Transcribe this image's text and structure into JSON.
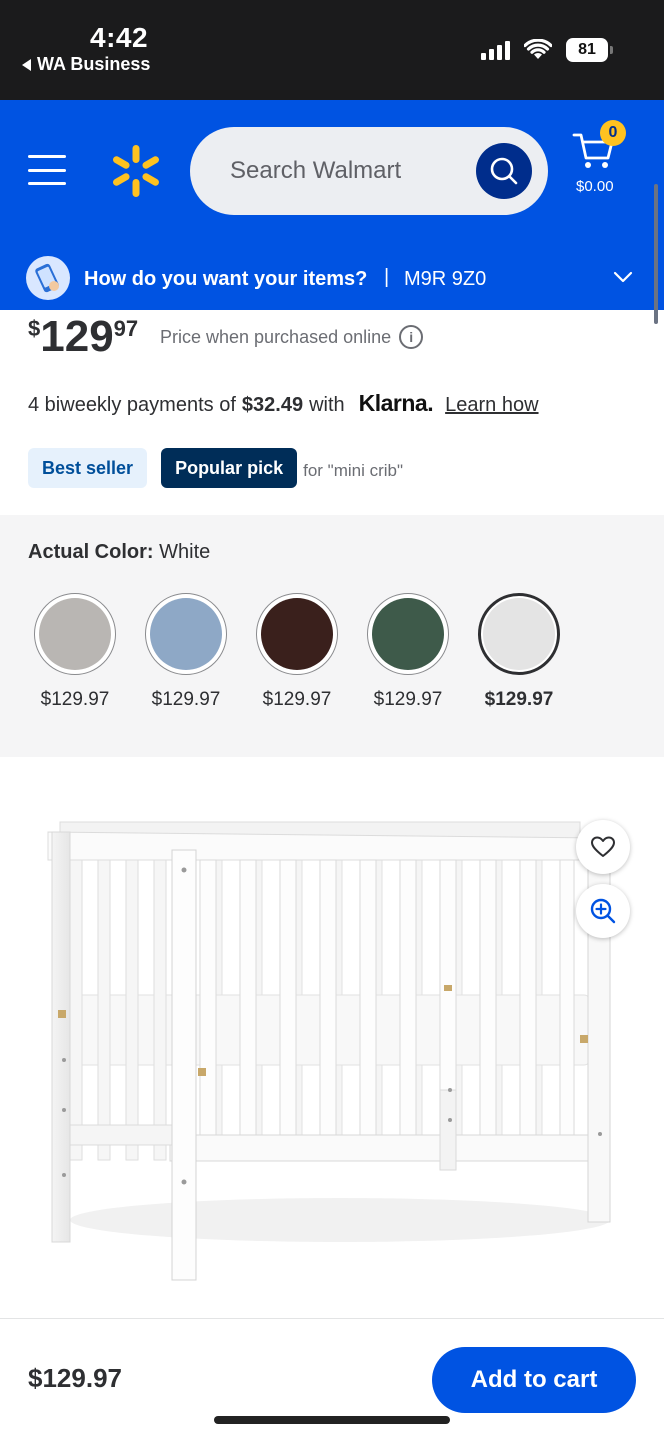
{
  "status_bar": {
    "time": "4:42",
    "back_app": "WA Business",
    "battery": "81"
  },
  "header": {
    "search_placeholder": "Search Walmart",
    "cart_count": "0",
    "cart_total": "$0.00",
    "brand_color": "#0053e2",
    "spark_color": "#ffc220"
  },
  "delivery": {
    "question": "How do you want your items?",
    "separator": "|",
    "postal_code": "M9R 9Z0"
  },
  "price": {
    "currency": "$",
    "dollars": "129",
    "cents": "97",
    "note": "Price when purchased online",
    "info_icon": "i"
  },
  "klarna": {
    "prefix": "4 biweekly payments of",
    "amount": "$32.49",
    "with": "with",
    "logo": "Klarna.",
    "link": "Learn how"
  },
  "badges": {
    "best_seller": "Best seller",
    "popular_pick": "Popular pick",
    "context": "for \"mini crib\""
  },
  "color": {
    "label": "Actual Color:",
    "selected": "White",
    "swatches": [
      {
        "color": "#b9b6b3",
        "price": "$129.97",
        "selected": false
      },
      {
        "color": "#8ea8c6",
        "price": "$129.97",
        "selected": false
      },
      {
        "color": "#3a201c",
        "price": "$129.97",
        "selected": false
      },
      {
        "color": "#3e5a4a",
        "price": "$129.97",
        "selected": false
      },
      {
        "color": "#e4e4e4",
        "price": "$129.97",
        "selected": true
      }
    ]
  },
  "product": {
    "image_icon": "crib-image",
    "favorite_icon": "heart-icon",
    "zoom_icon": "zoom-in-icon"
  },
  "bottom_bar": {
    "price": "$129.97",
    "add_to_cart": "Add to cart"
  }
}
